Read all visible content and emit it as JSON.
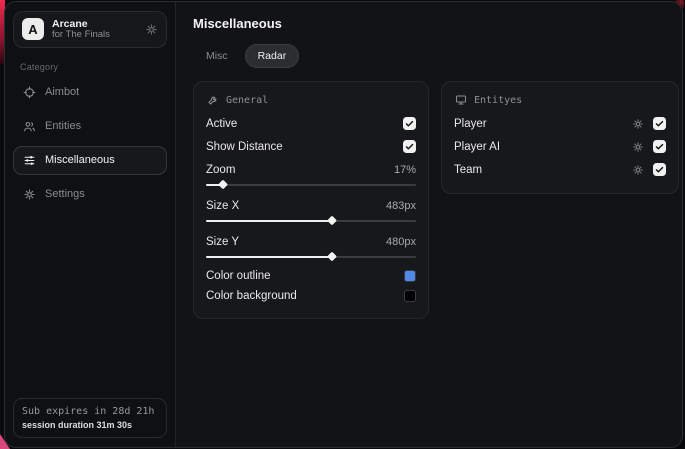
{
  "colors": {
    "accent_red": "#f02a50",
    "accent_pink": "#d8487c",
    "outline_swatch": "#5089e8",
    "background_swatch": "#000000"
  },
  "sidebar": {
    "brand": {
      "initial": "A",
      "name": "Arcane",
      "subtitle": "for The Finals"
    },
    "category_label": "Category",
    "items": [
      {
        "label": "Aimbot",
        "selected": false
      },
      {
        "label": "Entities",
        "selected": false
      },
      {
        "label": "Miscellaneous",
        "selected": true
      },
      {
        "label": "Settings",
        "selected": false
      }
    ],
    "subscription": {
      "line1": "Sub expires in 28d 21h",
      "line2": "session duration 31m 30s"
    }
  },
  "header": {
    "title": "Miscellaneous"
  },
  "tabs": [
    {
      "label": "Misc",
      "selected": false
    },
    {
      "label": "Radar",
      "selected": true
    }
  ],
  "panels": {
    "general": {
      "title": "General",
      "toggles": [
        {
          "label": "Active",
          "checked": true
        },
        {
          "label": "Show Distance",
          "checked": true
        }
      ],
      "sliders": [
        {
          "label": "Zoom",
          "value": "17%",
          "percent": 8
        },
        {
          "label": "Size X",
          "value": "483px",
          "percent": 60
        },
        {
          "label": "Size Y",
          "value": "480px",
          "percent": 60
        }
      ],
      "color_rows": [
        {
          "label": "Color outline",
          "hex": "#5089e8"
        },
        {
          "label": "Color background",
          "hex": "#000000"
        }
      ]
    },
    "entities": {
      "title": "Entityes",
      "rows": [
        {
          "label": "Player",
          "checked": true
        },
        {
          "label": "Player AI",
          "checked": true
        },
        {
          "label": "Team",
          "checked": true
        }
      ]
    }
  }
}
